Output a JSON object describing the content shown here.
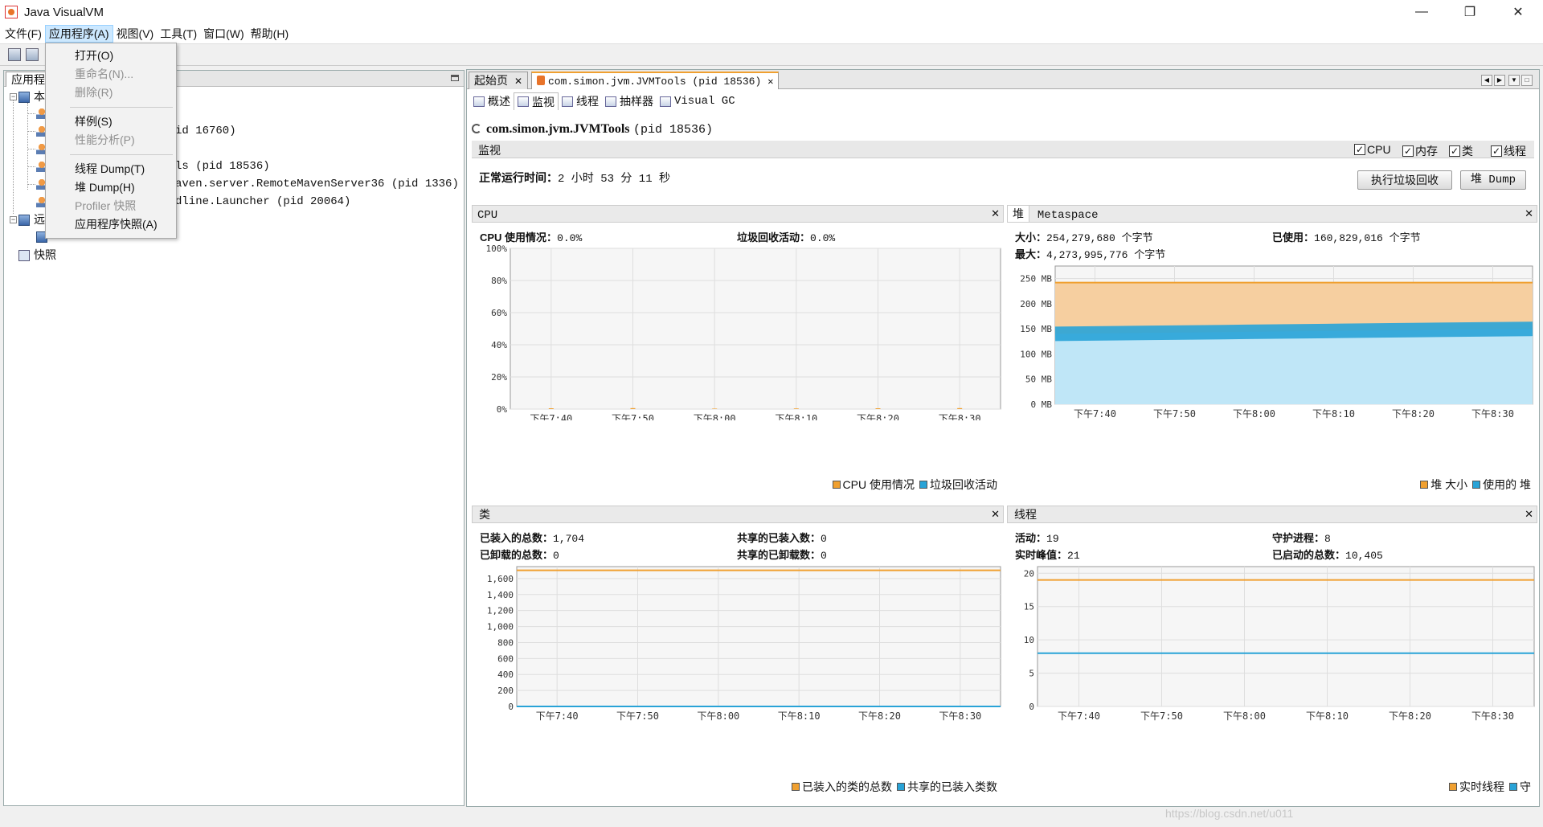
{
  "window": {
    "title": "Java VisualVM",
    "minimize": "—",
    "restore": "❐",
    "close": "✕"
  },
  "menubar": {
    "items": [
      "文件(F)",
      "应用程序(A)",
      "视图(V)",
      "工具(T)",
      "窗口(W)",
      "帮助(H)"
    ],
    "active_index": 1
  },
  "app_menu": {
    "items": [
      {
        "label": "打开(O)",
        "enabled": true
      },
      {
        "label": "重命名(N)...",
        "enabled": false
      },
      {
        "label": "删除(R)",
        "enabled": false
      },
      {
        "label": "样例(S)",
        "enabled": true
      },
      {
        "label": "性能分析(P)",
        "enabled": false
      },
      {
        "label": "线程 Dump(T)",
        "enabled": true
      },
      {
        "label": "堆 Dump(H)",
        "enabled": true
      },
      {
        "label": "Profiler 快照",
        "enabled": false
      },
      {
        "label": "应用程序快照(A)",
        "enabled": true
      }
    ]
  },
  "left_panel": {
    "tab_label": "应用程",
    "tree": {
      "local_label": "本",
      "remote_label": "远",
      "snapshots_label": "快照",
      "entries": [
        "id 16760)",
        "ls (pid 18536)",
        "aven.server.RemoteMavenServer36 (pid 1336)",
        "dline.Launcher (pid 20064)"
      ]
    }
  },
  "doc_tabs": [
    {
      "label": "起始页",
      "close": "✕"
    },
    {
      "label": "com.simon.jvm.JVMTools (pid 18536)",
      "close": "✕"
    }
  ],
  "sub_tabs": [
    "概述",
    "监视",
    "线程",
    "抽样器",
    "Visual GC"
  ],
  "sub_tab_selected": 1,
  "process": {
    "class_name": "com.simon.jvm.JVMTools",
    "pid_text": "(pid 18536)"
  },
  "monitor": {
    "title": "监视",
    "checkboxes": [
      "CPU",
      "内存",
      "类",
      "线程"
    ],
    "checkmark": "✓",
    "uptime_label": "正常运行时间：",
    "uptime_value": "2 小时 53 分 11 秒",
    "gc_button": "执行垃圾回收",
    "heap_dump_button": "堆 Dump"
  },
  "time_axis": [
    "下午7:40",
    "下午7:50",
    "下午8:00",
    "下午8:10",
    "下午8:20",
    "下午8:30"
  ],
  "cpu_panel": {
    "title": "CPU",
    "close": "✕",
    "usage_label": "CPU 使用情况：",
    "usage_value": "0.0%",
    "gc_label": "垃圾回收活动：",
    "gc_value": "0.0%",
    "legend": [
      "CPU 使用情况",
      "垃圾回收活动"
    ]
  },
  "heap_panel": {
    "tabs": [
      "堆",
      "Metaspace"
    ],
    "close": "✕",
    "size_label": "大小：",
    "size_value": "254,279,680 个字节",
    "used_label": "已使用：",
    "used_value": "160,829,016 个字节",
    "max_label": "最大：",
    "max_value": "4,273,995,776 个字节",
    "legend": [
      "堆 大小",
      "使用的 堆"
    ]
  },
  "classes_panel": {
    "title": "类",
    "close": "✕",
    "loaded_label": "已装入的总数：",
    "loaded_value": "1,704",
    "unloaded_label": "已卸载的总数：",
    "unloaded_value": "0",
    "shared_loaded_label": "共享的已装入数：",
    "shared_loaded_value": "0",
    "shared_unloaded_label": "共享的已卸载数：",
    "shared_unloaded_value": "0",
    "legend": [
      "已装入的类的总数",
      "共享的已装入类数"
    ]
  },
  "threads_panel": {
    "title": "线程",
    "close": "✕",
    "live_label": "活动：",
    "live_value": "19",
    "daemon_label": "守护进程：",
    "daemon_value": "8",
    "peak_label": "实时峰值：",
    "peak_value": "21",
    "started_label": "已启动的总数：",
    "started_value": "10,405",
    "legend": [
      "实时线程",
      "守"
    ]
  },
  "colors": {
    "orange": "#f0a030",
    "blue": "#29a3d7",
    "heap_fill": "#f6cfa0",
    "used_fill": "#bfe6f7",
    "menu_highlight": "#cce8ff"
  },
  "watermark": "https://blog.csdn.net/u011",
  "chart_data": [
    {
      "type": "area",
      "title": "CPU",
      "x": [
        "下午7:40",
        "下午7:50",
        "下午8:00",
        "下午8:10",
        "下午8:20",
        "下午8:30"
      ],
      "ylim": [
        0,
        100
      ],
      "yticks": [
        "0%",
        "20%",
        "40%",
        "60%",
        "80%",
        "100%"
      ],
      "series": [
        {
          "name": "CPU 使用情况",
          "values": [
            0.5,
            0.6,
            0.3,
            0.4,
            0.5,
            0.6
          ]
        },
        {
          "name": "垃圾回收活动",
          "values": [
            0,
            0,
            0,
            0,
            0,
            0
          ]
        }
      ],
      "legend": "bottom-right",
      "grid": true
    },
    {
      "type": "area",
      "title": "堆",
      "x": [
        "下午7:40",
        "下午7:50",
        "下午8:00",
        "下午8:10",
        "下午8:20",
        "下午8:30"
      ],
      "ylim": [
        0,
        275
      ],
      "yticks": [
        "0 MB",
        "50 MB",
        "100 MB",
        "150 MB",
        "200 MB",
        "250 MB"
      ],
      "series": [
        {
          "name": "堆 大小",
          "values": [
            242,
            242,
            242,
            242,
            242,
            242
          ]
        },
        {
          "name": "使用的 堆",
          "values": [
            140,
            142,
            144,
            146,
            148,
            150
          ]
        }
      ],
      "legend": "bottom-right",
      "grid": true
    },
    {
      "type": "line",
      "title": "类",
      "x": [
        "下午7:40",
        "下午7:50",
        "下午8:00",
        "下午8:10",
        "下午8:20",
        "下午8:30"
      ],
      "ylim": [
        0,
        1750
      ],
      "yticks": [
        "0",
        "200",
        "400",
        "600",
        "800",
        "1,000",
        "1,200",
        "1,400",
        "1,600"
      ],
      "series": [
        {
          "name": "已装入的类的总数",
          "values": [
            1704,
            1704,
            1704,
            1704,
            1704,
            1704
          ]
        },
        {
          "name": "共享的已装入类数",
          "values": [
            0,
            0,
            0,
            0,
            0,
            0
          ]
        }
      ],
      "legend": "bottom-right",
      "grid": true
    },
    {
      "type": "line",
      "title": "线程",
      "x": [
        "下午7:40",
        "下午7:50",
        "下午8:00",
        "下午8:10",
        "下午8:20",
        "下午8:30"
      ],
      "ylim": [
        0,
        21
      ],
      "yticks": [
        "0",
        "5",
        "10",
        "15",
        "20"
      ],
      "series": [
        {
          "name": "实时线程",
          "values": [
            19,
            19,
            19,
            19,
            19,
            19
          ]
        },
        {
          "name": "守",
          "values": [
            8,
            8,
            8,
            8,
            8,
            8
          ]
        }
      ],
      "legend": "bottom-right",
      "grid": true
    }
  ]
}
